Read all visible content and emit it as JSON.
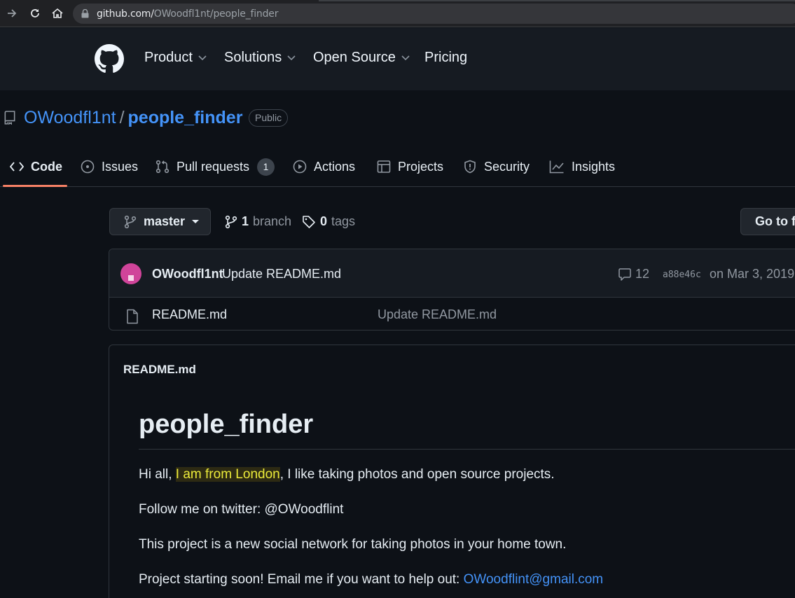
{
  "browser": {
    "url_host": "github.com/",
    "url_path": "OWoodfl1nt/people_finder"
  },
  "header": {
    "nav": [
      {
        "label": "Product",
        "has_menu": true
      },
      {
        "label": "Solutions",
        "has_menu": true
      },
      {
        "label": "Open Source",
        "has_menu": true
      },
      {
        "label": "Pricing",
        "has_menu": false
      }
    ]
  },
  "repo": {
    "owner": "OWoodfl1nt",
    "separator": "/",
    "name": "people_finder",
    "visibility": "Public"
  },
  "tabs": [
    {
      "label": "Code",
      "icon": "code-icon",
      "active": true
    },
    {
      "label": "Issues",
      "icon": "issue-icon"
    },
    {
      "label": "Pull requests",
      "icon": "pull-request-icon",
      "count": "1"
    },
    {
      "label": "Actions",
      "icon": "play-icon"
    },
    {
      "label": "Projects",
      "icon": "table-icon"
    },
    {
      "label": "Security",
      "icon": "shield-icon"
    },
    {
      "label": "Insights",
      "icon": "graph-icon"
    }
  ],
  "branch_bar": {
    "branch": "master",
    "branch_count": "1",
    "branch_label": "branch",
    "tag_count": "0",
    "tag_label": "tags",
    "goto_label": "Go to file"
  },
  "commit": {
    "author": "OWoodfl1nt",
    "message": "Update README.md",
    "comments": "12",
    "sha": "a88e46c",
    "date": "on Mar 3, 2019"
  },
  "files": [
    {
      "name": "README.md",
      "message": "Update README.md"
    }
  ],
  "readme": {
    "label": "README.md",
    "heading": "people_finder",
    "p1_before": "Hi all, ",
    "p1_highlight": "I am from London",
    "p1_after": ", I like taking photos and open source projects.",
    "p2": "Follow me on twitter: @OWoodflint",
    "p3": "This project is a new social network for taking photos in your home town.",
    "p4_text": "Project starting soon! Email me if you want to help out: ",
    "p4_email": "OWoodflint@gmail.com"
  },
  "colors": {
    "accent_link": "#4493f8",
    "active_tab_underline": "#f78166",
    "highlight_text": "#eceb3a"
  }
}
